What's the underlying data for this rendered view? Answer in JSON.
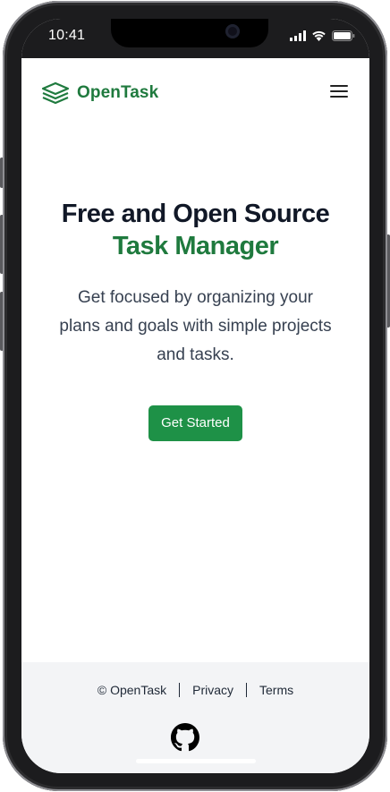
{
  "status_bar": {
    "time": "10:41",
    "icons": [
      "cellular-signal-icon",
      "wifi-icon",
      "battery-icon"
    ]
  },
  "header": {
    "logo_icon": "stacked-layers-icon",
    "logo_text": "OpenTask",
    "menu_icon": "hamburger-menu-icon"
  },
  "hero": {
    "title_line1": "Free and Open Source",
    "title_line2": "Task Manager",
    "description": "Get focused by organizing your plans and goals with simple projects and tasks.",
    "cta_label": "Get Started"
  },
  "footer": {
    "copyright": "© OpenTask",
    "privacy_label": "Privacy",
    "terms_label": "Terms",
    "github_icon": "github-icon"
  },
  "colors": {
    "brand_green": "#1f7a3e",
    "button_green": "#1e9147",
    "heading_dark": "#111827",
    "footer_bg": "#f3f4f6",
    "phone_frame": "#1c1c1e"
  }
}
